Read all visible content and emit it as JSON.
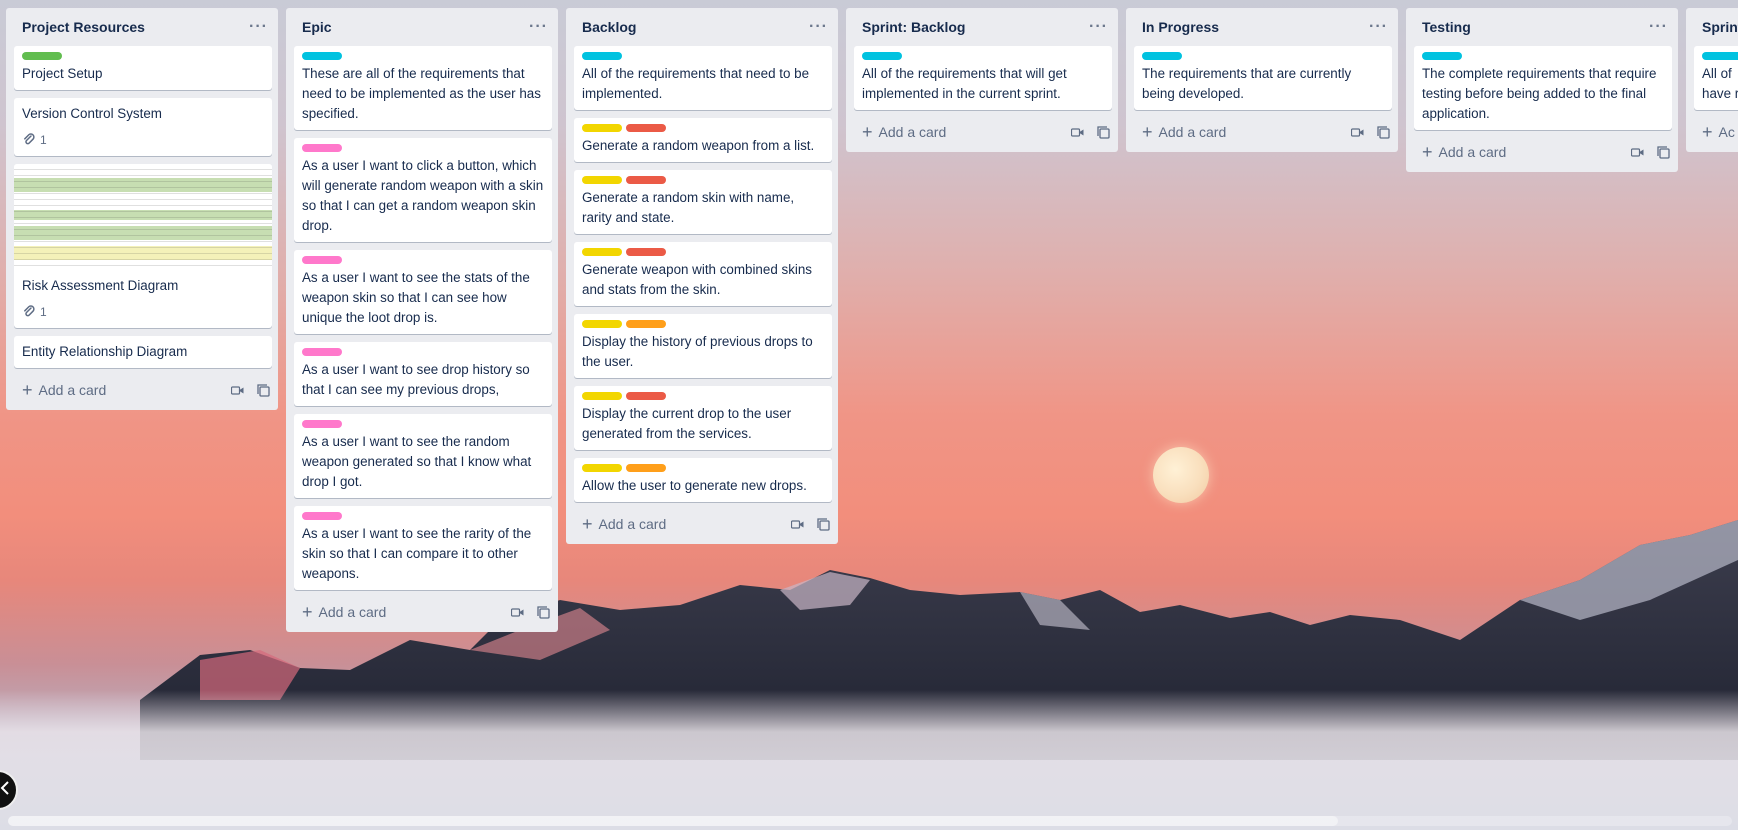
{
  "colors": {
    "green": "#61bd4f",
    "cyan": "#00c2e0",
    "pink": "#ff78cb",
    "yellow": "#f2d600",
    "red": "#eb5a46",
    "orange": "#ff9f1a"
  },
  "lists": [
    {
      "title": "Project Resources",
      "add_label": "Add a card",
      "cards": [
        {
          "text": "Project Setup",
          "labels": [
            "green"
          ]
        },
        {
          "text": "Version Control System",
          "attachments": "1"
        },
        {
          "text": "Risk Assessment Diagram",
          "attachments": "1",
          "cover": "spreadsheet-thumbnail"
        },
        {
          "text": "Entity Relationship Diagram"
        }
      ]
    },
    {
      "title": "Epic",
      "add_label": "Add a card",
      "cards": [
        {
          "text": "These are all of the requirements that need to be implemented as the user has specified.",
          "labels": [
            "cyan"
          ]
        },
        {
          "text": "As a user I want to click a button, which will generate random weapon with a skin so that I can get a random weapon skin drop.",
          "labels": [
            "pink"
          ]
        },
        {
          "text": "As a user I want to see the stats of the weapon skin so that I can see how unique the loot drop is.",
          "labels": [
            "pink"
          ]
        },
        {
          "text": "As a user I want to see drop history so that I can see my previous drops,",
          "labels": [
            "pink"
          ]
        },
        {
          "text": "As a user I want to see the random weapon generated so that I know what drop I got.",
          "labels": [
            "pink"
          ]
        },
        {
          "text": "As a user I want to see the rarity of the skin so that I can compare it to other weapons.",
          "labels": [
            "pink"
          ]
        }
      ]
    },
    {
      "title": "Backlog",
      "add_label": "Add a card",
      "cards": [
        {
          "text": "All of the requirements that need to be implemented.",
          "labels": [
            "cyan"
          ]
        },
        {
          "text": "Generate a random weapon from a list.",
          "labels": [
            "yellow",
            "red"
          ]
        },
        {
          "text": "Generate a random skin with name, rarity and state.",
          "labels": [
            "yellow",
            "red"
          ]
        },
        {
          "text": "Generate weapon with combined skins and stats from the skin.",
          "labels": [
            "yellow",
            "red"
          ]
        },
        {
          "text": "Display the history of previous drops to the user.",
          "labels": [
            "yellow",
            "orange"
          ]
        },
        {
          "text": "Display the current drop to the user generated from the services.",
          "labels": [
            "yellow",
            "red"
          ]
        },
        {
          "text": "Allow the user to generate new drops.",
          "labels": [
            "yellow",
            "orange"
          ]
        }
      ]
    },
    {
      "title": "Sprint: Backlog",
      "add_label": "Add a card",
      "cards": [
        {
          "text": "All of the requirements that will get implemented in the current sprint.",
          "labels": [
            "cyan"
          ]
        }
      ]
    },
    {
      "title": "In Progress",
      "add_label": "Add a card",
      "cards": [
        {
          "text": "The requirements that are currently being developed.",
          "labels": [
            "cyan"
          ]
        }
      ]
    },
    {
      "title": "Testing",
      "add_label": "Add a card",
      "cards": [
        {
          "text": "The complete requirements that require testing before being added to the final application.",
          "labels": [
            "cyan"
          ]
        }
      ]
    },
    {
      "title": "Sprint",
      "add_label": "Ac",
      "cards": [
        {
          "text": "All of have r",
          "labels": [
            "cyan"
          ]
        }
      ]
    }
  ]
}
